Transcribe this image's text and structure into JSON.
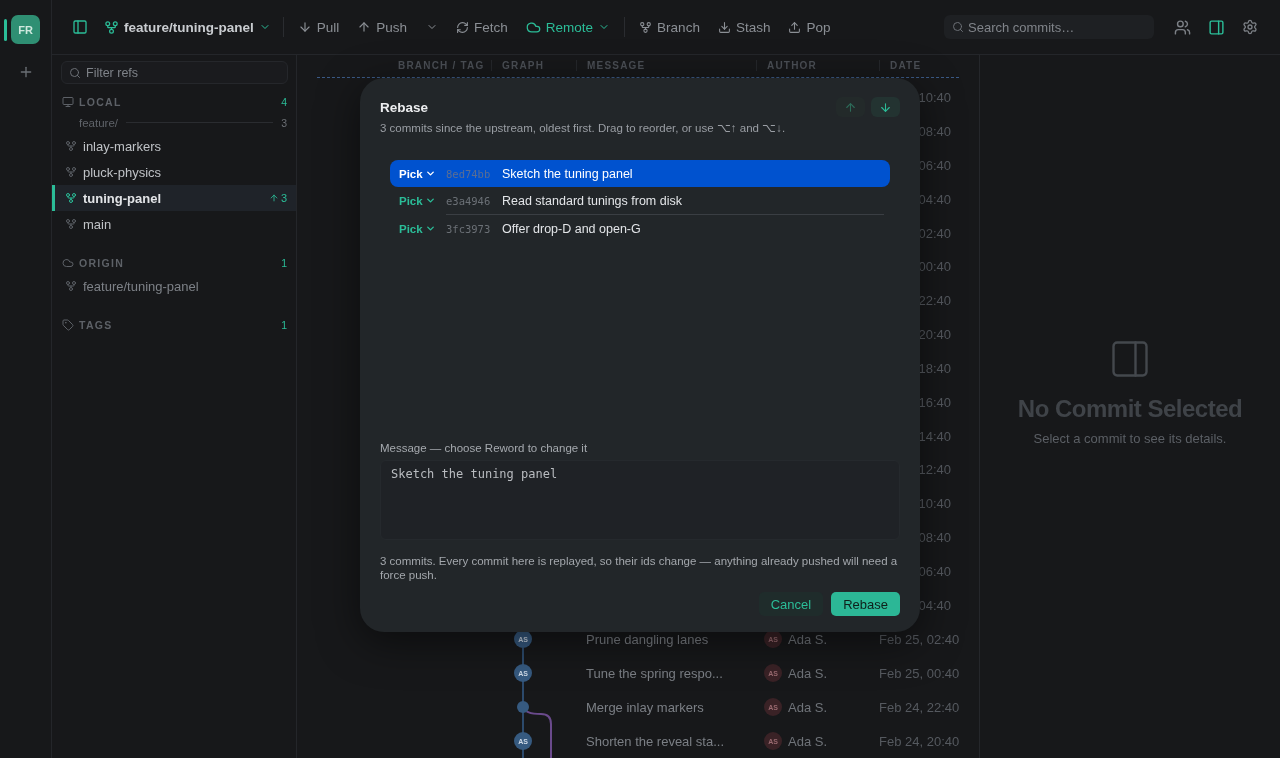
{
  "rail": {
    "avatar": "FR"
  },
  "toolbar": {
    "branch": "feature/tuning-panel",
    "action_groups": [
      [
        {
          "label": "Pull",
          "kind": "pull",
          "dropdown": false,
          "accent": false
        },
        {
          "label": "Push",
          "kind": "push",
          "dropdown": true,
          "accent": false
        },
        {
          "label": "Fetch",
          "kind": "fetch",
          "dropdown": false,
          "accent": false
        },
        {
          "label": "Remote",
          "kind": "remote",
          "dropdown": true,
          "accent": true
        }
      ],
      [
        {
          "label": "Branch",
          "kind": "branch",
          "dropdown": false,
          "accent": false
        },
        {
          "label": "Stash",
          "kind": "stash",
          "dropdown": false,
          "accent": false
        },
        {
          "label": "Pop",
          "kind": "pop",
          "dropdown": false,
          "accent": false
        }
      ]
    ],
    "search": {
      "placeholder": "Search commits…"
    },
    "inspector_on": true
  },
  "sidebar": {
    "filter": {
      "placeholder": "Filter refs"
    },
    "sections": [
      {
        "kind": "local",
        "label": "LOCAL",
        "count": "4",
        "items": [
          {
            "kind": "group",
            "label": "feature/",
            "count": "3",
            "children": [
              {
                "kind": "branch",
                "label": "inlay-markers",
                "selected": false
              },
              {
                "kind": "branch",
                "label": "pluck-physics",
                "selected": false
              },
              {
                "kind": "branch",
                "label": "tuning-panel",
                "selected": true,
                "ahead": "3"
              }
            ]
          },
          {
            "kind": "branch",
            "label": "main",
            "selected": false
          }
        ]
      },
      {
        "kind": "remote",
        "label": "ORIGIN",
        "count": "1",
        "items": [
          {
            "kind": "branch",
            "label": "feature/tuning-panel",
            "selected": false,
            "dim": true
          }
        ]
      },
      {
        "kind": "tags",
        "label": "TAGS",
        "count": "1"
      }
    ]
  },
  "table": {
    "columns": [
      "BRANCH / TAG",
      "GRAPH",
      "MESSAGE",
      "AUTHOR",
      "DATE"
    ],
    "rows": [
      {
        "date": "10:40"
      },
      {
        "date": "08:40"
      },
      {
        "date": "06:40"
      },
      {
        "date": "04:40"
      },
      {
        "date": "02:40"
      },
      {
        "date": "00:40"
      },
      {
        "date": "22:40"
      },
      {
        "date": "20:40"
      },
      {
        "date": "18:40"
      },
      {
        "date": "16:40"
      },
      {
        "date": "14:40"
      },
      {
        "date": "12:40"
      },
      {
        "date": "10:40"
      },
      {
        "date": "08:40"
      },
      {
        "date": "06:40"
      },
      {
        "date": "04:40"
      },
      {
        "graph": {
          "initials": "AS",
          "branch_start": false,
          "branch_through": false
        },
        "message": "Prune dangling lanes",
        "author_initials": "AS",
        "author": "Ada S.",
        "date": "Feb 25, 02:40"
      },
      {
        "graph": {
          "initials": "AS",
          "branch_start": false,
          "branch_through": false
        },
        "message": "Tune the spring respo...",
        "author_initials": "AS",
        "author": "Ada S.",
        "date": "Feb 25, 00:40"
      },
      {
        "graph": {
          "branch_start": true,
          "branch_through": false
        },
        "message": "Merge inlay markers",
        "author_initials": "AS",
        "author": "Ada S.",
        "date": "Feb 24, 22:40"
      },
      {
        "graph": {
          "initials": "AS",
          "branch_start": false,
          "branch_through": true
        },
        "message": "Shorten the reveal sta...",
        "author_initials": "AS",
        "author": "Ada S.",
        "date": "Feb 24, 20:40"
      }
    ]
  },
  "details": {
    "title": "No Commit Selected",
    "hint": "Select a commit to see its details."
  },
  "dialog": {
    "title": "Rebase",
    "subtitle": "3 commits since the upstream, oldest first. Drag to reorder, or use ⌥↑ and ⌥↓.",
    "move_up_disabled": true,
    "move_down_disabled": false,
    "commits": [
      {
        "action": "Pick",
        "hash": "8ed74bb",
        "message": "Sketch the tuning panel",
        "selected": true
      },
      {
        "action": "Pick",
        "hash": "e3a4946",
        "message": "Read standard tunings from disk",
        "selected": false
      },
      {
        "action": "Pick",
        "hash": "3fc3973",
        "message": "Offer drop-D and open-G",
        "selected": false
      }
    ],
    "message_label": "Message — choose Reword to change it",
    "message": "Sketch the tuning panel",
    "note": "3 commits. Every commit here is replayed, so their ids change — anything already pushed will need a force push.",
    "buttons": [
      {
        "label": "Cancel",
        "kind": "secondary"
      },
      {
        "label": "Rebase",
        "kind": "primary"
      }
    ]
  }
}
